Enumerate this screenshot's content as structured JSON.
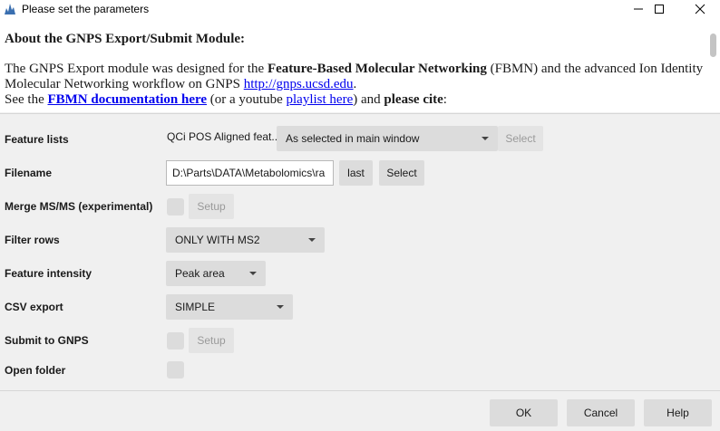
{
  "window": {
    "title": "Please set the parameters"
  },
  "about": {
    "heading": "About the GNPS Export/Submit Module:",
    "p1_a": "The GNPS Export module was designed for the ",
    "p1_b": "Feature-Based Molecular Networking",
    "p1_c": " (FBMN) and the advanced Ion Identity Molecular Networking workflow on GNPS ",
    "p1_link": "http://gnps.ucsd.edu",
    "p1_d": ".",
    "p2_a": "See the ",
    "p2_link1": "FBMN documentation here",
    "p2_b": " (or a youtube ",
    "p2_link2": "playlist here",
    "p2_c": ") and ",
    "p2_d": "please cite",
    "p2_e": ":"
  },
  "params": {
    "feature_lists": {
      "label": "Feature lists",
      "value_text": "QCi POS Aligned feat...",
      "dropdown": "As selected in main window",
      "select_button": "Select"
    },
    "filename": {
      "label": "Filename",
      "value": "D:\\Parts\\DATA\\Metabolomics\\ra",
      "last_button": "last",
      "select_button": "Select"
    },
    "merge_msms": {
      "label": "Merge MS/MS (experimental)",
      "setup_button": "Setup"
    },
    "filter_rows": {
      "label": "Filter rows",
      "value": "ONLY WITH MS2"
    },
    "feature_intensity": {
      "label": "Feature intensity",
      "value": "Peak area"
    },
    "csv_export": {
      "label": "CSV export",
      "value": "SIMPLE"
    },
    "submit_gnps": {
      "label": "Submit to GNPS",
      "setup_button": "Setup"
    },
    "open_folder": {
      "label": "Open folder"
    }
  },
  "buttons": {
    "ok": "OK",
    "cancel": "Cancel",
    "help": "Help"
  },
  "colors": {
    "link": "#0000ee",
    "control_bg": "#dcdcdc",
    "window_bg": "#f0f0f0"
  }
}
